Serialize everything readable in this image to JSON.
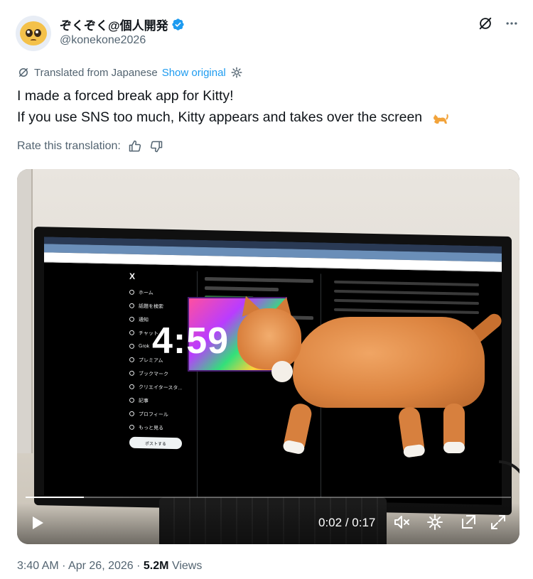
{
  "author": {
    "display_name": "ぞくぞく@個人開発",
    "handle": "@konekone2026",
    "avatar_emoji": "pleading-face",
    "verified": true
  },
  "translation": {
    "notice": "Translated from Japanese",
    "show_original": "Show original",
    "rate_label": "Rate this translation:"
  },
  "tweet": {
    "line1": "I made a forced break app for Kitty!",
    "line2": "If you use SNS too much, Kitty appears and takes over the screen"
  },
  "video": {
    "overlay_clock": "4:59",
    "time_current": "0:02",
    "time_separator": "/",
    "time_total": "0:17",
    "progress": 0.12,
    "screen_nav": [
      "ホーム",
      "話題を検索",
      "通知",
      "チャット",
      "Grok",
      "プレミアム",
      "ブックマーク",
      "クリエイタースタ...",
      "記事",
      "プロフィール",
      "もっと見る"
    ],
    "post_button": "ポストする"
  },
  "meta": {
    "time": "3:40 AM",
    "dot1": "·",
    "date": "Apr 26, 2026",
    "dot2": "·",
    "views_count": "5.2M",
    "views_label": "Views"
  },
  "colors": {
    "link": "#1d9bf0",
    "secondary_text": "#536471",
    "primary_text": "#0f1419",
    "verified": "#1d9bf0"
  },
  "icons": {
    "grok": "grok-icon",
    "more": "more-icon",
    "translate": "translate-icon",
    "settings": "gear-icon",
    "thumb_up": "thumb-up-icon",
    "thumb_down": "thumb-down-icon",
    "play": "play-icon",
    "mute": "mute-icon",
    "popout": "popout-icon",
    "fullscreen": "fullscreen-icon"
  }
}
